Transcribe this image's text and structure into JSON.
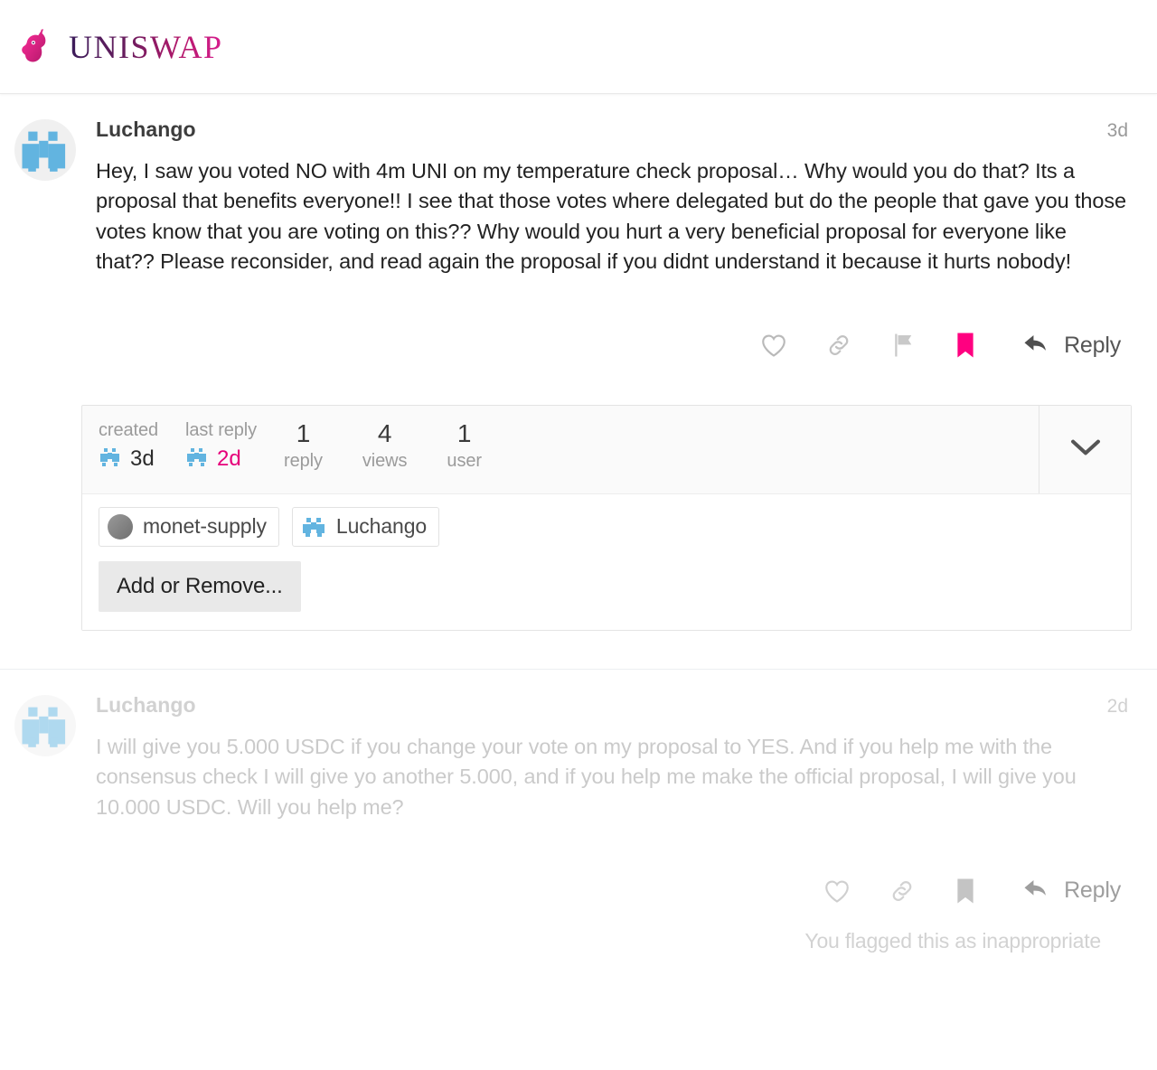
{
  "header": {
    "brand_name": "UNISWAP",
    "logo_icon": "unicorn-logo",
    "brand_gradient_start": "#3a1c5a",
    "brand_gradient_end": "#d81e8f"
  },
  "theme": {
    "accent_pink": "#e6007a",
    "bookmarked_color": "#ff0080",
    "text_color": "#222222",
    "muted_color": "#9b9b9b"
  },
  "posts": [
    {
      "username": "Luchango",
      "timestamp": "3d",
      "avatar_icon": "pixel-avatar-luchango",
      "body": "Hey, I saw you voted NO with 4m UNI on my temperature check proposal… Why would you do that? Its a proposal that benefits everyone!! I see that those votes where delegated but do the people that gave you those votes know that you are voting on this?? Why would you hurt a very beneficial proposal for everyone like that?? Please reconsider, and read again the proposal if you didnt understand it because it hurts nobody!",
      "actions": {
        "like": "heart-icon",
        "link": "link-icon",
        "flag": "flag-icon",
        "bookmark": "bookmark-icon",
        "reply_label": "Reply"
      }
    },
    {
      "username": "Luchango",
      "timestamp": "2d",
      "avatar_icon": "pixel-avatar-luchango",
      "body": "I will give you 5.000 USDC if you change your vote on my proposal to YES. And if you help me with the consensus check I will give yo another 5.000, and if you help me make the official proposal, I will give you 10.000 USDC. Will you help me?",
      "actions": {
        "like": "heart-icon",
        "link": "link-icon",
        "bookmark": "bookmark-icon",
        "reply_label": "Reply"
      },
      "flag_notice": "You flagged this as inappropriate"
    }
  ],
  "topic_map": {
    "created_label": "created",
    "created_value": "3d",
    "last_reply_label": "last reply",
    "last_reply_value": "2d",
    "replies_count": "1",
    "replies_label": "reply",
    "views_count": "4",
    "views_label": "views",
    "users_count": "1",
    "users_label": "user",
    "expand_icon": "chevron-down-icon",
    "participants": [
      {
        "name": "monet-supply",
        "avatar_icon": "gray-circle-avatar"
      },
      {
        "name": "Luchango",
        "avatar_icon": "pixel-avatar-luchango"
      }
    ],
    "add_remove_label": "Add or Remove..."
  }
}
